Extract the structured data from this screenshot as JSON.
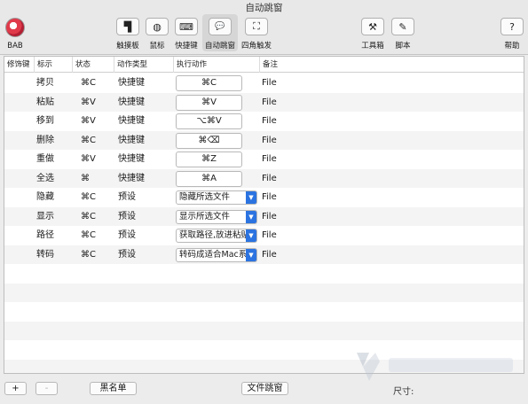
{
  "window": {
    "title": "自动跳窗"
  },
  "toolbar": {
    "app_label": "BAB",
    "items": [
      {
        "label": "触摸板",
        "icon": "trackpad-icon",
        "glyph": "▜"
      },
      {
        "label": "鼠标",
        "icon": "mouse-icon",
        "glyph": "◍"
      },
      {
        "label": "快捷键",
        "icon": "keyboard-icon",
        "glyph": "⌨"
      },
      {
        "label": "自动跳窗",
        "icon": "speech-bubble-icon",
        "glyph": "💬"
      },
      {
        "label": "四角触发",
        "icon": "corners-icon",
        "glyph": "⛶"
      },
      {
        "label": "工具箱",
        "icon": "toolbox-icon",
        "glyph": "⚒"
      },
      {
        "label": "脚本",
        "icon": "pen-icon",
        "glyph": "✎"
      },
      {
        "label": "帮助",
        "icon": "help-icon",
        "glyph": "?"
      }
    ]
  },
  "table": {
    "headers": [
      "修饰键",
      "标示",
      "状态",
      "动作类型",
      "执行动作",
      "备注"
    ],
    "rows": [
      {
        "mark": "拷贝",
        "state": "⌘C",
        "type": "快捷键",
        "action": "⌘C",
        "action_kind": "key",
        "note": "File"
      },
      {
        "mark": "粘贴",
        "state": "⌘V",
        "type": "快捷键",
        "action": "⌘V",
        "action_kind": "key",
        "note": "File"
      },
      {
        "mark": "移到",
        "state": "⌘V",
        "type": "快捷键",
        "action": "⌥⌘V",
        "action_kind": "key",
        "note": "File"
      },
      {
        "mark": "删除",
        "state": "⌘C",
        "type": "快捷键",
        "action": "⌘⌫",
        "action_kind": "key",
        "note": "File"
      },
      {
        "mark": "重做",
        "state": "⌘V",
        "type": "快捷键",
        "action": "⌘Z",
        "action_kind": "key",
        "note": "File"
      },
      {
        "mark": "全选",
        "state": "⌘",
        "type": "快捷键",
        "action": "⌘A",
        "action_kind": "key",
        "note": "File"
      },
      {
        "mark": "隐藏",
        "state": "⌘C",
        "type": "预设",
        "action": "隐藏所选文件",
        "action_kind": "select",
        "note": "File"
      },
      {
        "mark": "显示",
        "state": "⌘C",
        "type": "预设",
        "action": "显示所选文件",
        "action_kind": "select",
        "note": "File"
      },
      {
        "mark": "路径",
        "state": "⌘C",
        "type": "预设",
        "action": "获取路径,放进粘贴",
        "action_kind": "select",
        "note": "File"
      },
      {
        "mark": "转码",
        "state": "⌘C",
        "type": "预设",
        "action": "转码成适合Mac系",
        "action_kind": "select",
        "note": "File"
      }
    ]
  },
  "bottom": {
    "add_label": "+",
    "remove_label": "-",
    "blacklist_label": "黑名单",
    "file_jump_label": "文件跳窗",
    "size_label": "尺寸:"
  },
  "colors": {
    "accent": "#2b73e0",
    "row_alt": "#f4f4f4"
  }
}
